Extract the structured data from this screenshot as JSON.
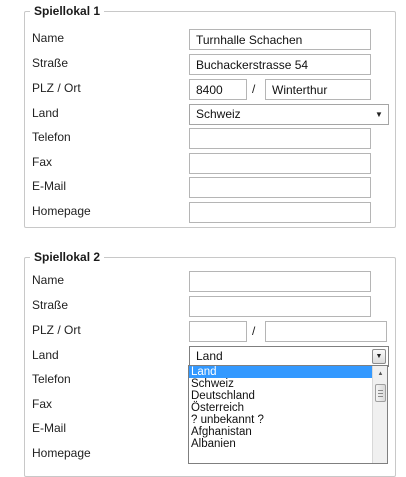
{
  "sections": [
    {
      "legend": "Spiellokal 1",
      "labels": {
        "name": "Name",
        "strasse": "Straße",
        "plz_ort": "PLZ / Ort",
        "land": "Land",
        "telefon": "Telefon",
        "fax": "Fax",
        "email": "E-Mail",
        "homepage": "Homepage"
      },
      "values": {
        "name": "Turnhalle Schachen",
        "strasse": "Buchackerstrasse 54",
        "plz": "8400",
        "ort": "Winterthur",
        "land": "Schweiz",
        "telefon": "",
        "fax": "",
        "email": "",
        "homepage": ""
      },
      "separator": "/"
    },
    {
      "legend": "Spiellokal 2",
      "labels": {
        "name": "Name",
        "strasse": "Straße",
        "plz_ort": "PLZ / Ort",
        "land": "Land",
        "telefon": "Telefon",
        "fax": "Fax",
        "email": "E-Mail",
        "homepage": "Homepage"
      },
      "values": {
        "name": "",
        "strasse": "",
        "plz": "",
        "ort": "",
        "land": "Land",
        "telefon": "",
        "fax": "",
        "email": "",
        "homepage": ""
      },
      "separator": "/"
    }
  ],
  "land_dropdown": {
    "open": true,
    "options": [
      "Land",
      "Schweiz",
      "Deutschland",
      "Österreich",
      "? unbekannt ?",
      "Afghanistan",
      "Albanien"
    ],
    "highlighted": "Land",
    "highlight_color": "#3399ff"
  },
  "icons": {
    "select_arrow": "chevron-down-icon",
    "scroll_up": "scroll-up-arrow-icon"
  }
}
